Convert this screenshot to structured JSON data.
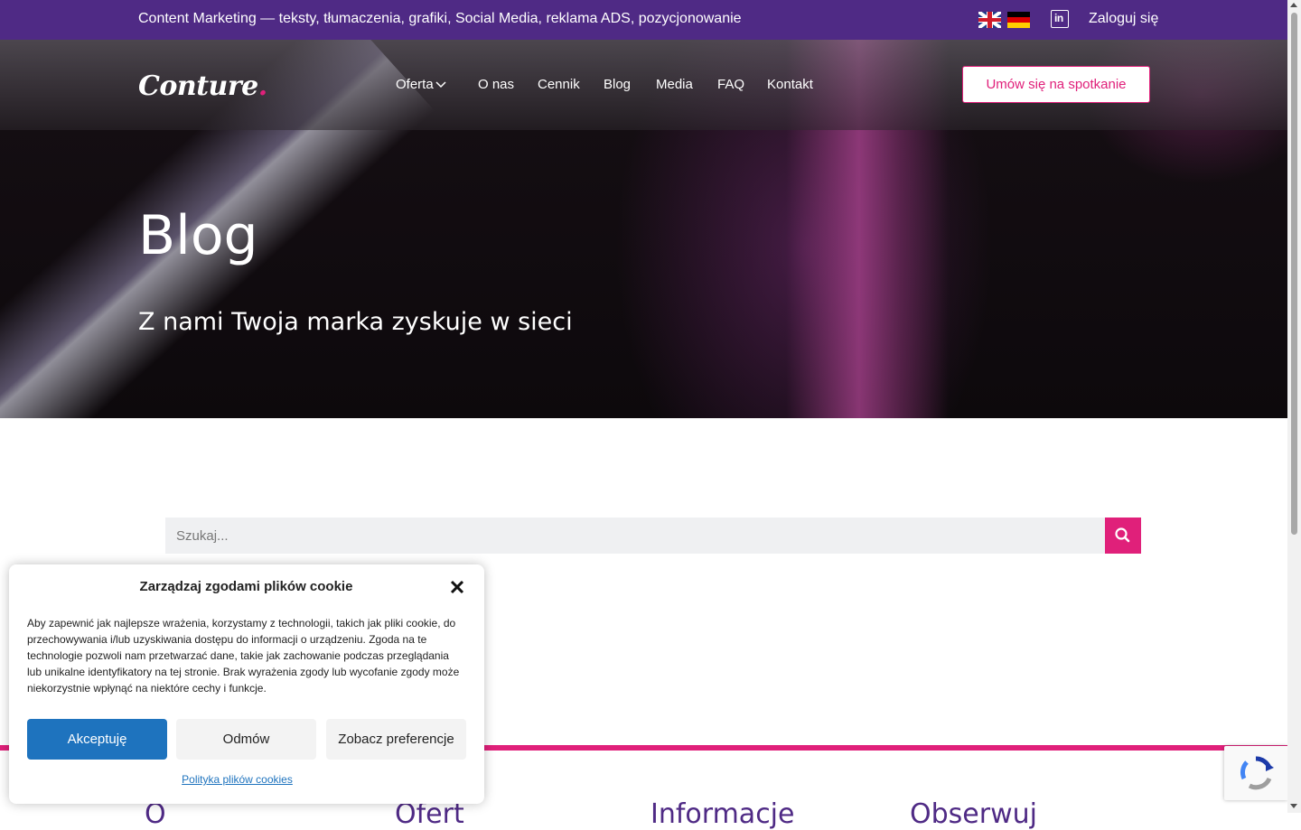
{
  "topbar": {
    "tagline": "Content Marketing — teksty, tłumaczenia, grafiki, Social Media, reklama ADS, pozycjonowanie",
    "login": "Zaloguj się",
    "linkedin_icon": "linkedin-icon",
    "flags": [
      "uk-flag-icon",
      "de-flag-icon"
    ]
  },
  "header": {
    "logo_text": "Conture",
    "logo_dot": ".",
    "nav": [
      "Oferta",
      "O nas",
      "Cennik",
      "Blog",
      "Media",
      "FAQ",
      "Kontakt"
    ],
    "cta": "Umów się na spotkanie"
  },
  "hero": {
    "title": "Blog",
    "subtitle": "Z nami Twoja marka zyskuje w sieci"
  },
  "search": {
    "placeholder": "Szukaj...",
    "button_icon": "search-icon"
  },
  "footer": {
    "headings": [
      "O",
      "Ofert",
      "Informacje",
      "Obserwuj"
    ]
  },
  "cookie": {
    "title": "Zarządzaj zgodami plików cookie",
    "body": "Aby zapewnić jak najlepsze wrażenia, korzystamy z technologii, takich jak pliki cookie, do przechowywania i/lub uzyskiwania dostępu do informacji o urządzeniu. Zgoda na te technologie pozwoli nam przetwarzać dane, takie jak zachowanie podczas przeglądania lub unikalne identyfikatory na tej stronie. Brak wyrażenia zgody lub wycofanie zgody może niekorzystnie wpłynąć na niektóre cechy i funkcje.",
    "accept": "Akceptuję",
    "deny": "Odmów",
    "preferences": "Zobacz preferencje",
    "policy": "Polityka plików cookies"
  },
  "colors": {
    "topbar": "#4f2a85",
    "accent": "#e0207a",
    "accept_button": "#1e73be"
  }
}
